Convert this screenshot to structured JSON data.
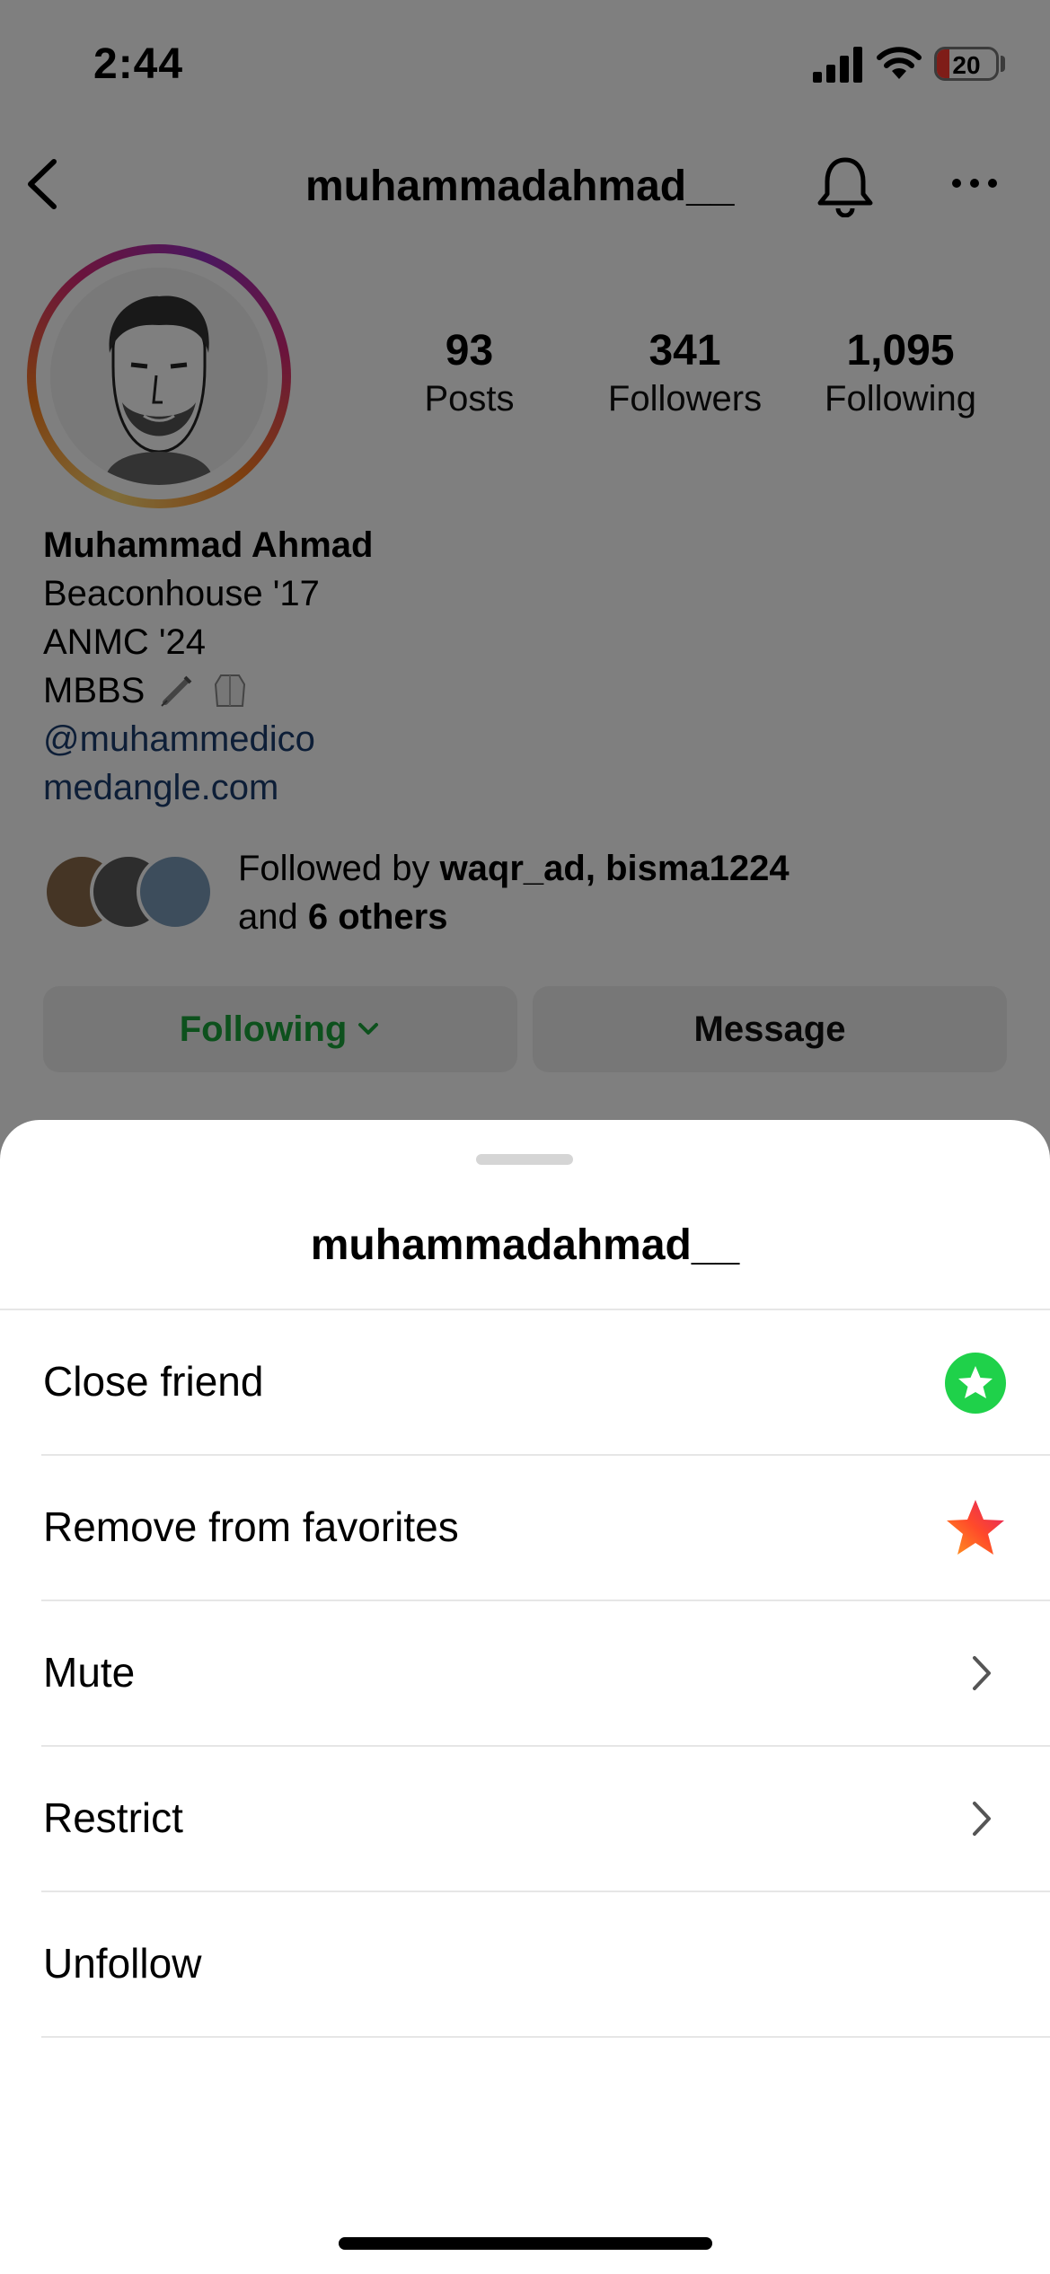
{
  "status_bar": {
    "time": "2:44",
    "battery": "20",
    "battery_color": "#ff3b30"
  },
  "header": {
    "username": "muhammadahmad__",
    "icons": [
      "back-icon",
      "bell-icon",
      "more-icon"
    ]
  },
  "stats": [
    {
      "value": "93",
      "label": "Posts"
    },
    {
      "value": "341",
      "label": "Followers"
    },
    {
      "value": "1,095",
      "label": "Following"
    }
  ],
  "bio": {
    "name": "Muhammad Ahmad",
    "lines": [
      "Beaconhouse '17",
      "ANMC '24",
      "MBBS"
    ],
    "mention": "@muhammedico",
    "link": "medangle.com"
  },
  "followed_by": {
    "prefix": "Followed by ",
    "users": "waqr_ad, bisma1224",
    "and": "and ",
    "others": "6 others"
  },
  "buttons": {
    "following": "Following",
    "message": "Message",
    "following_color": "#1aa33a"
  },
  "sheet": {
    "title": "muhammadahmad__",
    "items": [
      {
        "label": "Close friend",
        "icon": "green-star-icon"
      },
      {
        "label": "Remove from favorites",
        "icon": "favorite-star-icon"
      },
      {
        "label": "Mute",
        "icon": "chevron-right-icon"
      },
      {
        "label": "Restrict",
        "icon": "chevron-right-icon"
      },
      {
        "label": "Unfollow",
        "icon": ""
      }
    ],
    "close_friend_color": "#1fd14a"
  }
}
